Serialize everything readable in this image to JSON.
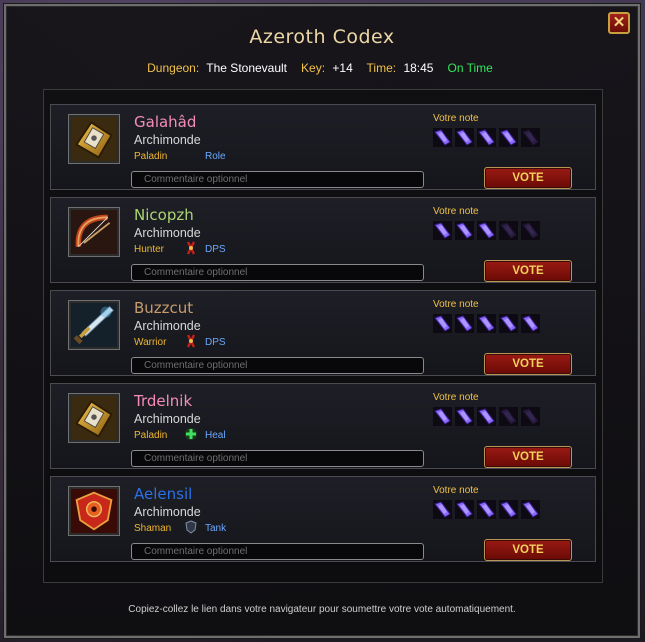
{
  "window": {
    "title": "Azeroth Codex",
    "close_label": "✕"
  },
  "info": {
    "dungeon_label": "Dungeon:",
    "dungeon": "The Stonevault",
    "key_label": "Key:",
    "key": "+14",
    "time_label": "Time:",
    "time": "18:45",
    "status": "On Time",
    "status_color": "#30e85a"
  },
  "players": [
    {
      "name": "Galahâd",
      "name_color": "#f58cba",
      "realm": "Archimonde",
      "class": "Paladin",
      "role": "Role",
      "role_icon": "none",
      "avatar_icon": "paladin-hammer-icon",
      "note_label": "Votre note",
      "rating": 4,
      "max_rating": 5,
      "comment_placeholder": "Commentaire optionnel",
      "vote_label": "VOTE"
    },
    {
      "name": "Nicopzh",
      "name_color": "#abd473",
      "realm": "Archimonde",
      "class": "Hunter",
      "role": "DPS",
      "role_icon": "dps-icon",
      "avatar_icon": "hunter-bow-icon",
      "note_label": "Votre note",
      "rating": 3,
      "max_rating": 5,
      "comment_placeholder": "Commentaire optionnel",
      "vote_label": "VOTE"
    },
    {
      "name": "Buzzcut",
      "name_color": "#c79c6e",
      "realm": "Archimonde",
      "class": "Warrior",
      "role": "DPS",
      "role_icon": "dps-icon",
      "avatar_icon": "warrior-sword-icon",
      "note_label": "Votre note",
      "rating": 5,
      "max_rating": 5,
      "comment_placeholder": "Commentaire optionnel",
      "vote_label": "VOTE"
    },
    {
      "name": "Trdelnik",
      "name_color": "#f58cba",
      "realm": "Archimonde",
      "class": "Paladin",
      "role": "Heal",
      "role_icon": "heal-icon",
      "avatar_icon": "paladin-hammer-icon",
      "note_label": "Votre note",
      "rating": 3,
      "max_rating": 5,
      "comment_placeholder": "Commentaire optionnel",
      "vote_label": "VOTE"
    },
    {
      "name": "Aelensil",
      "name_color": "#2a70e8",
      "realm": "Archimonde",
      "class": "Shaman",
      "role": "Tank",
      "role_icon": "tank-icon",
      "avatar_icon": "shaman-shield-icon",
      "note_label": "Votre note",
      "rating": 5,
      "max_rating": 5,
      "comment_placeholder": "Commentaire optionnel",
      "vote_label": "VOTE"
    }
  ],
  "footer": "Copiez-collez le lien dans votre navigateur pour soumettre votre vote automatiquement."
}
